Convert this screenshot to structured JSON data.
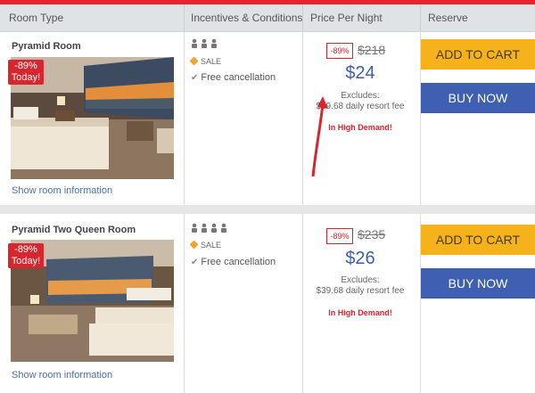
{
  "header": {
    "col_room": "Room Type",
    "col_incentives": "Incentives & Conditions",
    "col_price": "Price Per Night",
    "col_reserve": "Reserve"
  },
  "rooms": [
    {
      "name": "Pyramid Room",
      "discount_tag": [
        "-89%",
        "Today!"
      ],
      "show_info": "Show room information",
      "sale": "SALE",
      "cancellation": "Free cancellation",
      "discount_badge": "-89%",
      "old_price": "$218",
      "new_price": "$24",
      "excludes_line1": "Excludes:",
      "excludes_line2": "$39.68 daily resort fee",
      "demand": "In High Demand!",
      "add_to_cart": "ADD TO CART",
      "buy_now": "BUY NOW",
      "occupancy_icons": 3
    },
    {
      "name": "Pyramid Two Queen Room",
      "discount_tag": [
        "-89%",
        "Today!"
      ],
      "show_info": "Show room information",
      "sale": "SALE",
      "cancellation": "Free cancellation",
      "discount_badge": "-89%",
      "old_price": "$235",
      "new_price": "$26",
      "excludes_line1": "Excludes:",
      "excludes_line2": "$39.68 daily resort fee",
      "demand": "In High Demand!",
      "add_to_cart": "ADD TO CART",
      "buy_now": "BUY NOW",
      "occupancy_icons": 4
    }
  ],
  "colors": {
    "accent_red": "#d8262e",
    "cart_yellow": "#f5b21b",
    "buy_blue": "#3f5fb3",
    "price_blue": "#3f5ea8"
  }
}
